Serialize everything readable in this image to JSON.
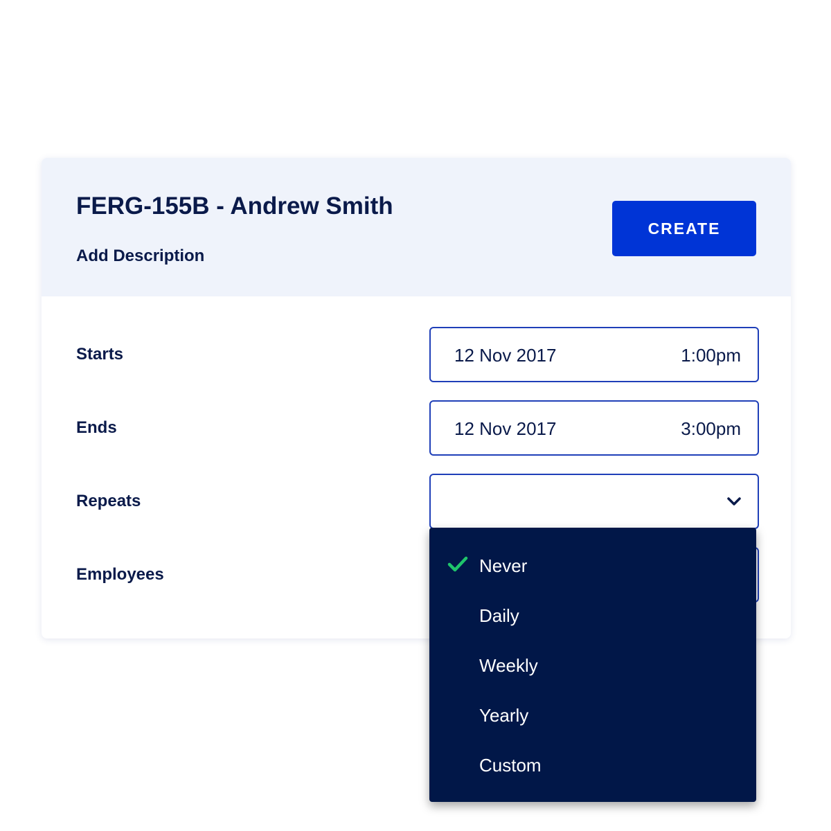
{
  "header": {
    "title": "FERG-155B - Andrew Smith",
    "description_link": "Add Description",
    "create_label": "CREATE"
  },
  "rows": {
    "starts": {
      "label": "Starts",
      "date": "12 Nov 2017",
      "time": "1:00pm"
    },
    "ends": {
      "label": "Ends",
      "date": "12 Nov 2017",
      "time": "3:00pm"
    },
    "repeats": {
      "label": "Repeats",
      "value": ""
    },
    "employees": {
      "label": "Employees"
    }
  },
  "repeat_options": [
    {
      "label": "Never",
      "selected": true
    },
    {
      "label": "Daily",
      "selected": false
    },
    {
      "label": "Weekly",
      "selected": false
    },
    {
      "label": "Yearly",
      "selected": false
    },
    {
      "label": "Custom",
      "selected": false
    }
  ],
  "colors": {
    "primary": "#0034d6",
    "navy": "#0a1a4a",
    "dropdown_bg": "#011748",
    "header_bg": "#eff3fb",
    "check": "#1fc46b",
    "field_border": "#1f3fb8"
  },
  "icons": {
    "chevron": "chevron-down-icon",
    "check": "checkmark-icon"
  }
}
